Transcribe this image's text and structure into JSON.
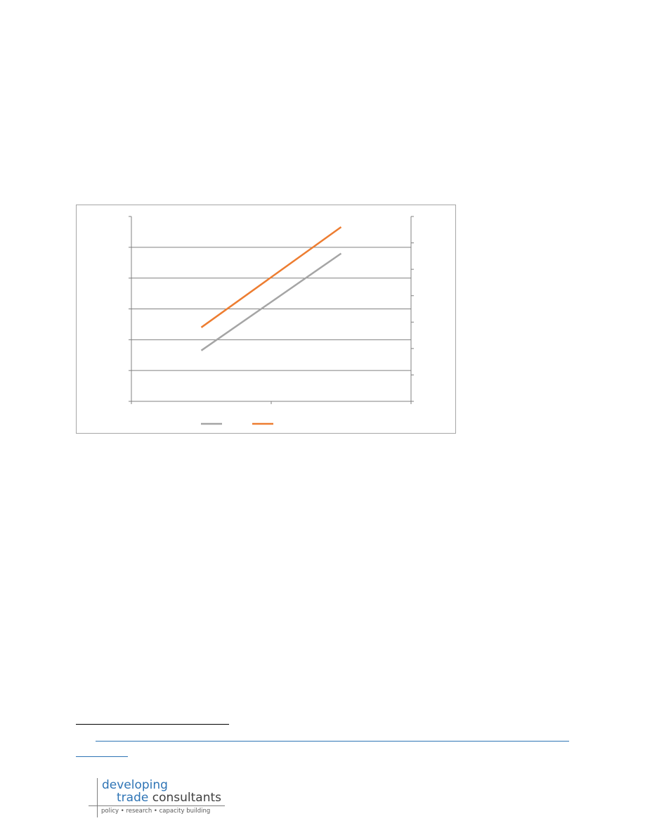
{
  "chart_data": {
    "type": "line",
    "title": "",
    "xlabel": "",
    "ylabel": "",
    "y2label": "",
    "categories": [
      "",
      "",
      ""
    ],
    "grid": true,
    "legend": "bottom",
    "ylim": [
      0,
      6
    ],
    "y2lim": [
      0,
      7
    ],
    "series": [
      {
        "axis": "left",
        "color": "#a5a5a5",
        "values": [
          1.65,
          4.8
        ]
      },
      {
        "axis": "right",
        "color": "#ed7d31",
        "values": [
          2.8,
          6.6
        ]
      }
    ]
  },
  "logo": {
    "line1": "developing",
    "line2_a": "trade",
    "line2_b": "consultants",
    "tagline": "policy  •  research  •  capacity building",
    "colors": {
      "blue": "#2e74b5",
      "gray": "#404040"
    }
  }
}
